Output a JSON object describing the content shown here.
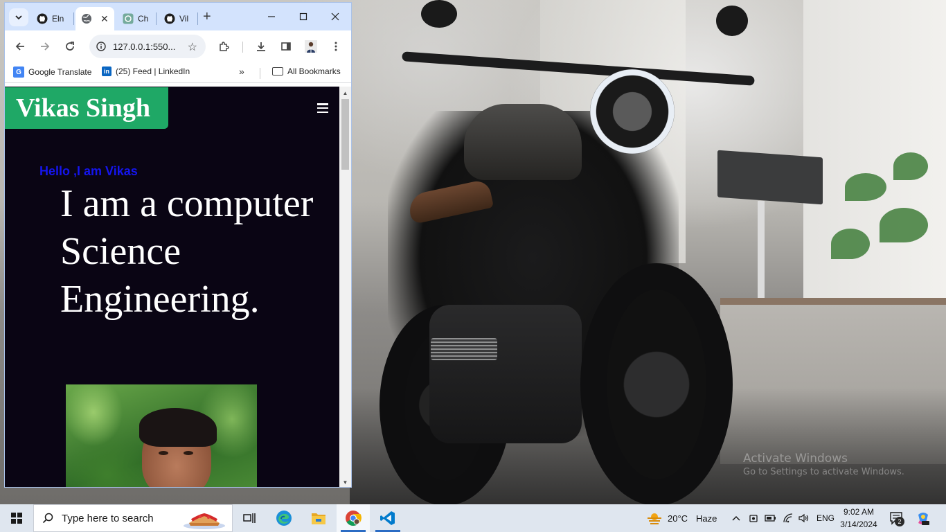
{
  "browser": {
    "tabs": [
      {
        "label": "Eln",
        "icon": "github-icon",
        "active": false
      },
      {
        "label": "",
        "icon": "globe-icon",
        "active": true
      },
      {
        "label": "Ch",
        "icon": "chatgpt-icon",
        "active": false
      },
      {
        "label": "Vil",
        "icon": "github-icon",
        "active": false
      }
    ],
    "tab_close": "✕",
    "new_tab": "+",
    "window_controls": {
      "minimize": "—",
      "maximize": "☐",
      "close": "✕"
    },
    "url": "127.0.0.1:550...",
    "bookmarks": [
      {
        "label": "Google Translate",
        "icon": "google-translate-icon"
      },
      {
        "label": "(25) Feed | LinkedIn",
        "icon": "linkedin-icon"
      }
    ],
    "bookmarks_overflow": "»",
    "all_bookmarks": "All Bookmarks"
  },
  "page": {
    "brand": "Vikas Singh",
    "greeting": "Hello ,I am Vikas",
    "headline": "I am a computer Science Engineering."
  },
  "desktop": {
    "watermark_title": "Activate Windows",
    "watermark_sub": "Go to Settings to activate Windows."
  },
  "taskbar": {
    "search_placeholder": "Type here to search",
    "apps": [
      "task-view-icon",
      "edge-icon",
      "file-explorer-icon",
      "chrome-icon",
      "vscode-icon"
    ],
    "weather_temp": "20°C",
    "weather_text": "Haze",
    "language": "ENG",
    "time": "9:02 AM",
    "date": "3/14/2024",
    "notification_count": "2"
  }
}
